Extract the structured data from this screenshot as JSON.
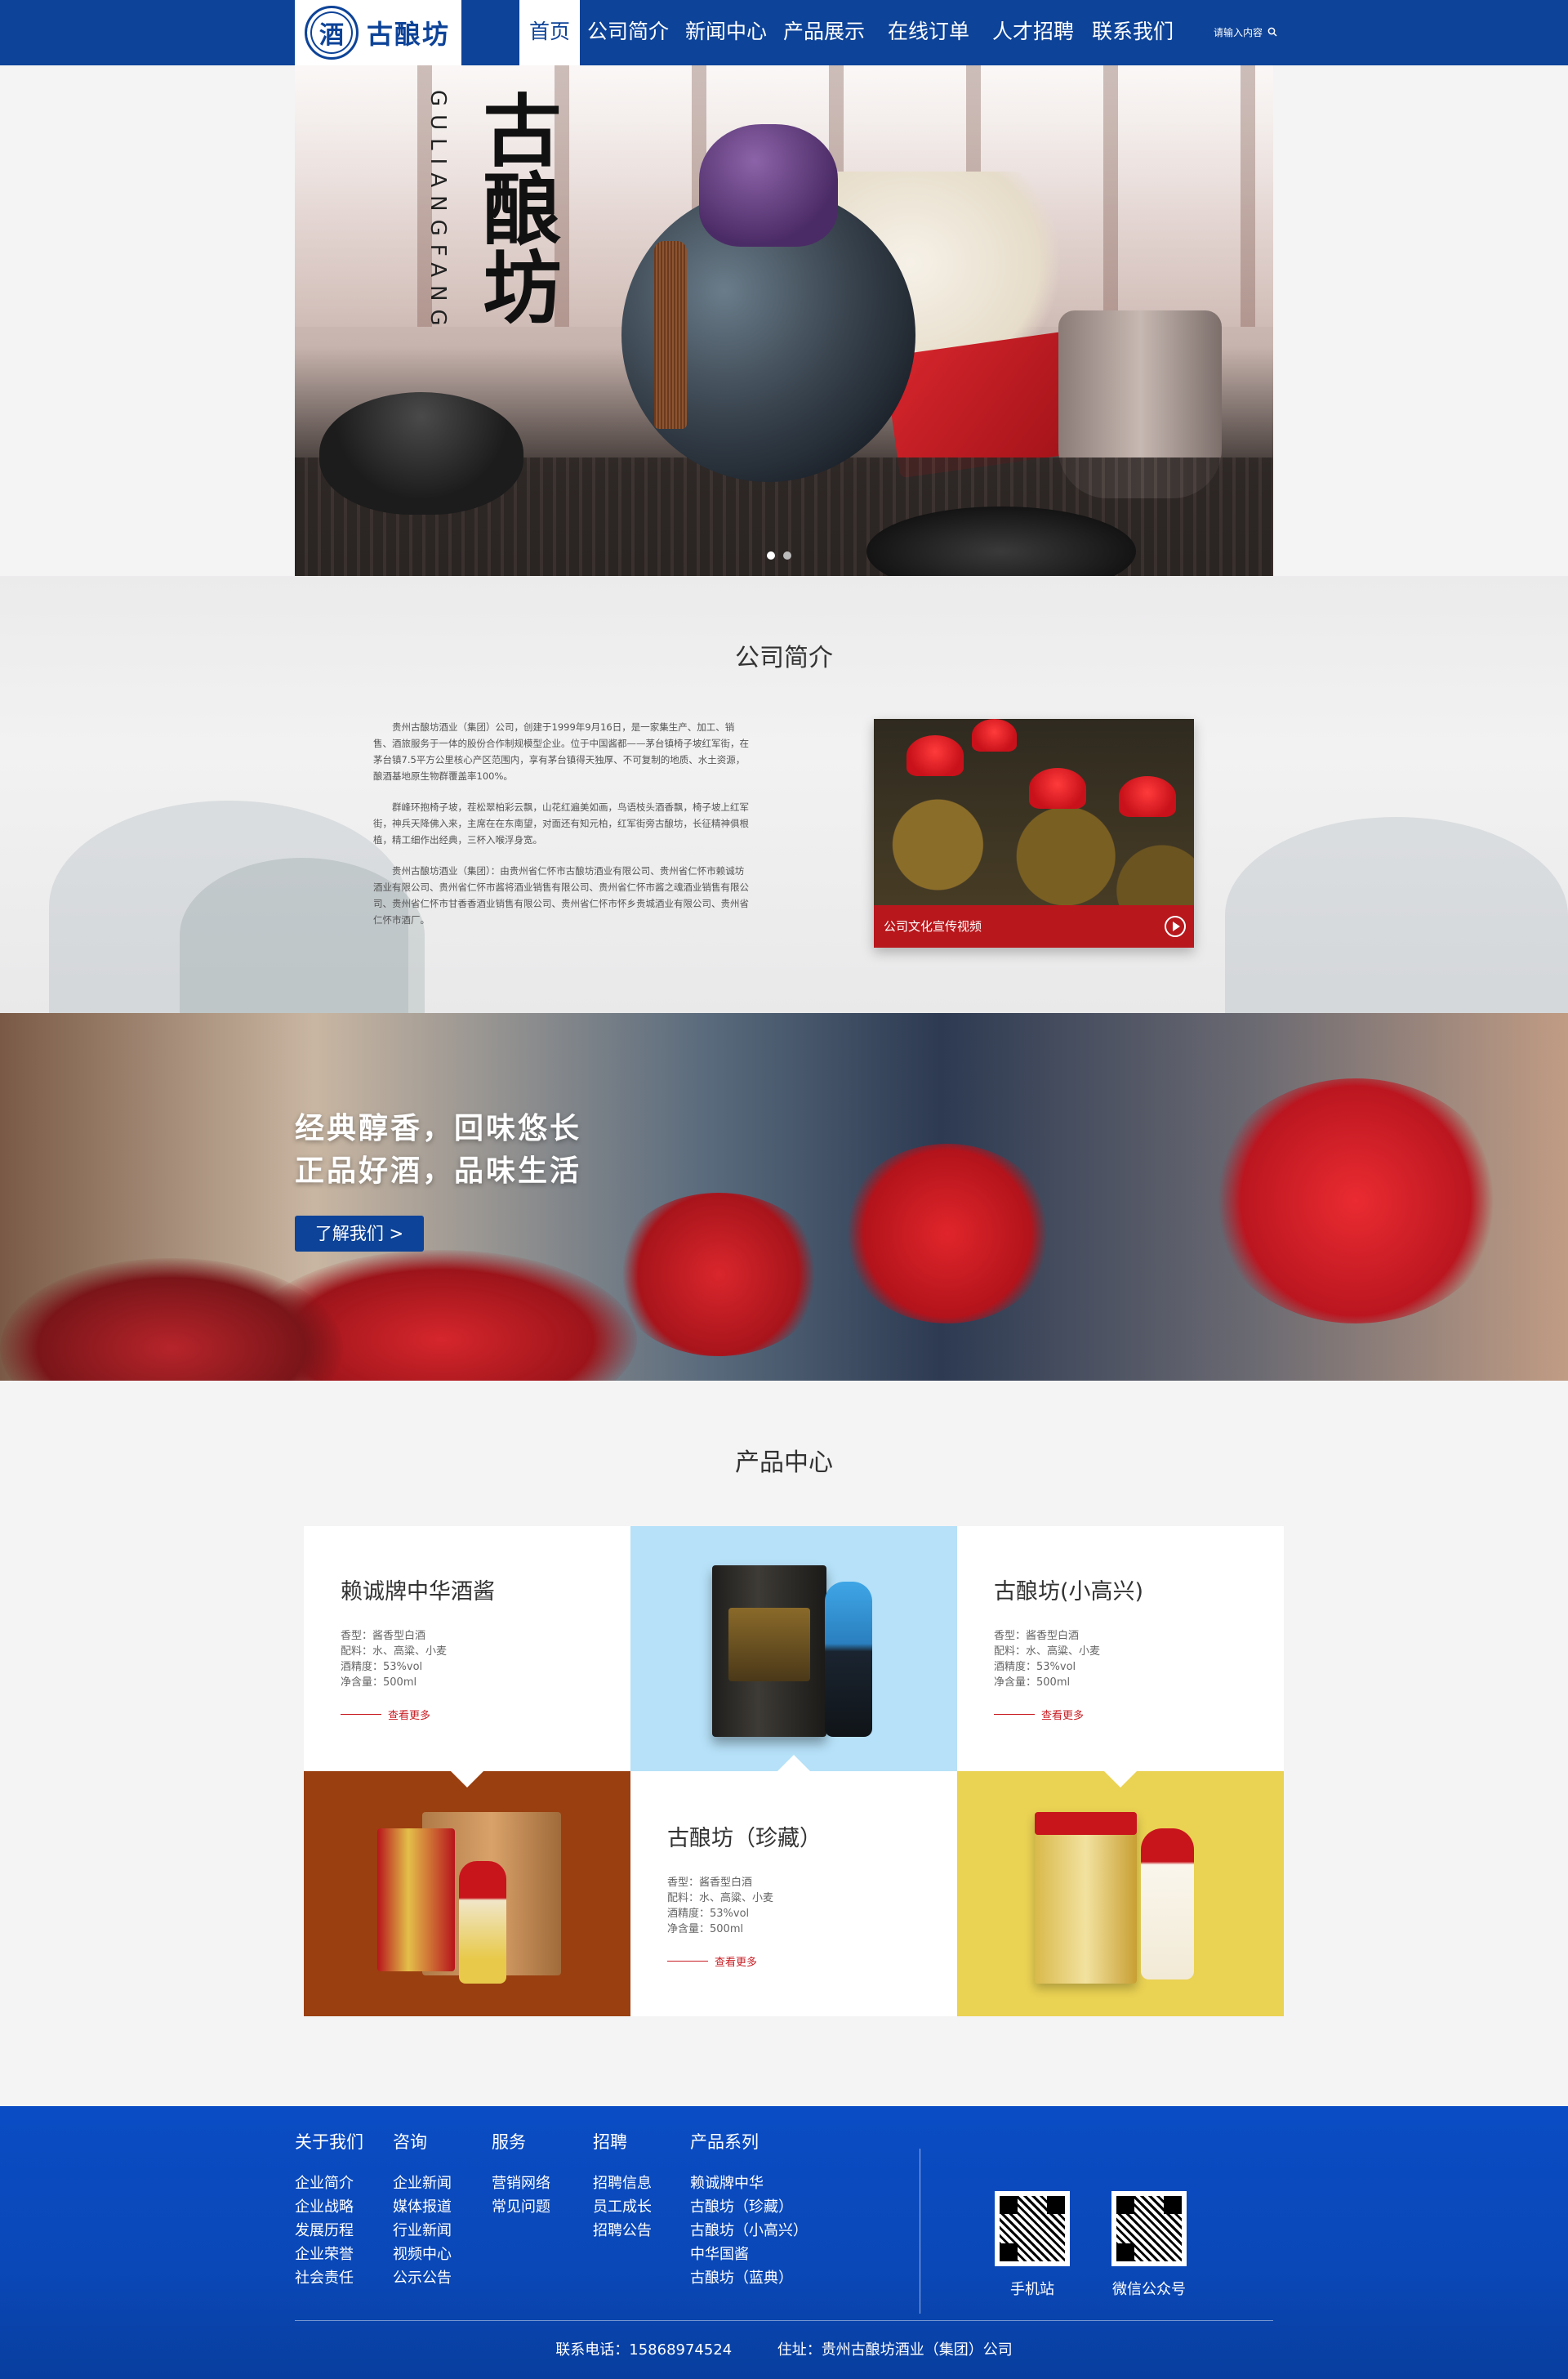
{
  "nav": {
    "logo_text": "古酿坊",
    "items": [
      "首页",
      "公司简介",
      "新闻中心",
      "产品展示",
      "在线订单",
      "人才招聘",
      "联系我们"
    ],
    "search_placeholder": "请输入内容"
  },
  "hero": {
    "brand_cn": "古酿坊",
    "brand_en": "GULIANGFANG"
  },
  "about": {
    "title": "公司简介",
    "paragraphs": [
      "贵州古酿坊酒业（集团）公司，创建于1999年9月16日，是一家集生产、加工、销售、酒旅服务于一体的股份合作制规模型企业。位于中国酱都——茅台镇椅子坡红军街，在茅台镇7.5平方公里核心产区范围内，享有茅台镇得天独厚、不可复制的地质、水土资源，酿酒基地原生物群覆盖率100%。",
      "群峰环抱椅子坡，茬松翠柏彩云飘，山花红遍美如画，鸟语枝头酒香飘，椅子坡上红军街，神兵天降佛入来，主席在在东南望，对面还有知元柏，红军街旁古酿坊，长征精神俱根植，精工细作出经典，三杯入喉浮身宽。",
      "贵州古酿坊酒业（集团）：由贵州省仁怀市古酿坊酒业有限公司、贵州省仁怀市赖诚坊酒业有限公司、贵州省仁怀市酱将酒业销售有限公司、贵州省仁怀市酱之魂酒业销售有限公司、贵州省仁怀市甘香香酒业销售有限公司、贵州省仁怀市怀乡贵城酒业有限公司、贵州省仁怀市酒厂。"
    ],
    "video_label": "公司文化宣传视频"
  },
  "banner": {
    "slogan_line1": "经典醇香，回味悠长",
    "slogan_line2": "正品好酒，品味生活",
    "button_label": "了解我们 >"
  },
  "products": {
    "title": "产品中心",
    "more_label": "查看更多",
    "items": [
      {
        "name": "赖诚牌中华酒酱",
        "specs": [
          "香型：酱香型白酒",
          "配料：水、高粱、小麦",
          "酒精度：53%vol",
          "净含量：500ml"
        ]
      },
      {
        "name": "古酿坊(小高兴)",
        "specs": [
          "香型：酱香型白酒",
          "配料：水、高粱、小麦",
          "酒精度：53%vol",
          "净含量：500ml"
        ]
      },
      {
        "name": "古酿坊（珍藏）",
        "specs": [
          "香型：酱香型白酒",
          "配料：水、高粱、小麦",
          "酒精度：53%vol",
          "净含量：500ml"
        ]
      }
    ],
    "colors": {
      "sky": "#b6e1f8",
      "brown": "#9a3f10",
      "yellow": "#ead253"
    }
  },
  "footer": {
    "columns": [
      {
        "heading": "关于我们",
        "items": [
          "企业简介",
          "企业战略",
          "发展历程",
          "企业荣誉",
          "社会责任"
        ]
      },
      {
        "heading": "咨询",
        "items": [
          "企业新闻",
          "媒体报道",
          "行业新闻",
          "视频中心",
          "公示公告"
        ]
      },
      {
        "heading": "服务",
        "items": [
          "营销网络",
          "常见问题"
        ]
      },
      {
        "heading": "招聘",
        "items": [
          "招聘信息",
          "员工成长",
          "招聘公告"
        ]
      },
      {
        "heading": "产品系列",
        "items": [
          "赖诚牌中华",
          "古酿坊（珍藏）",
          "古酿坊（小高兴）",
          "中华国酱",
          "古酿坊（蓝典）"
        ]
      }
    ],
    "qr_labels": [
      "手机站",
      "微信公众号"
    ],
    "phone": "联系电话：15868974524",
    "address": "住址：贵州古酿坊酒业（集团）公司"
  }
}
